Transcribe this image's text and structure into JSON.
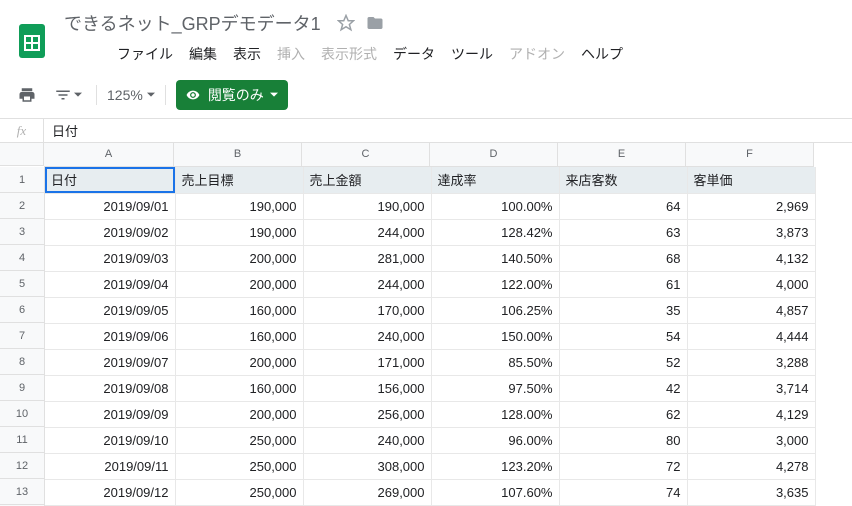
{
  "header": {
    "title": "できるネット_GRPデモデータ1"
  },
  "menu": {
    "file": "ファイル",
    "edit": "編集",
    "view": "表示",
    "insert": "挿入",
    "format": "表示形式",
    "data": "データ",
    "tools": "ツール",
    "addons": "アドオン",
    "help": "ヘルプ"
  },
  "toolbar": {
    "zoom": "125%",
    "view_only": "閲覧のみ"
  },
  "fx": {
    "label": "fx",
    "value": "日付"
  },
  "columns": [
    "A",
    "B",
    "C",
    "D",
    "E",
    "F"
  ],
  "row_numbers": [
    "1",
    "2",
    "3",
    "4",
    "5",
    "6",
    "7",
    "8",
    "9",
    "10",
    "11",
    "12",
    "13"
  ],
  "table": {
    "headers": {
      "c0": "日付",
      "c1": "売上目標",
      "c2": "売上金額",
      "c3": "達成率",
      "c4": "来店客数",
      "c5": "客単価"
    },
    "rows": [
      {
        "c0": "2019/09/01",
        "c1": "190,000",
        "c2": "190,000",
        "c3": "100.00%",
        "c4": "64",
        "c5": "2,969"
      },
      {
        "c0": "2019/09/02",
        "c1": "190,000",
        "c2": "244,000",
        "c3": "128.42%",
        "c4": "63",
        "c5": "3,873"
      },
      {
        "c0": "2019/09/03",
        "c1": "200,000",
        "c2": "281,000",
        "c3": "140.50%",
        "c4": "68",
        "c5": "4,132"
      },
      {
        "c0": "2019/09/04",
        "c1": "200,000",
        "c2": "244,000",
        "c3": "122.00%",
        "c4": "61",
        "c5": "4,000"
      },
      {
        "c0": "2019/09/05",
        "c1": "160,000",
        "c2": "170,000",
        "c3": "106.25%",
        "c4": "35",
        "c5": "4,857"
      },
      {
        "c0": "2019/09/06",
        "c1": "160,000",
        "c2": "240,000",
        "c3": "150.00%",
        "c4": "54",
        "c5": "4,444"
      },
      {
        "c0": "2019/09/07",
        "c1": "200,000",
        "c2": "171,000",
        "c3": "85.50%",
        "c4": "52",
        "c5": "3,288"
      },
      {
        "c0": "2019/09/08",
        "c1": "160,000",
        "c2": "156,000",
        "c3": "97.50%",
        "c4": "42",
        "c5": "3,714"
      },
      {
        "c0": "2019/09/09",
        "c1": "200,000",
        "c2": "256,000",
        "c3": "128.00%",
        "c4": "62",
        "c5": "4,129"
      },
      {
        "c0": "2019/09/10",
        "c1": "250,000",
        "c2": "240,000",
        "c3": "96.00%",
        "c4": "80",
        "c5": "3,000"
      },
      {
        "c0": "2019/09/11",
        "c1": "250,000",
        "c2": "308,000",
        "c3": "123.20%",
        "c4": "72",
        "c5": "4,278"
      },
      {
        "c0": "2019/09/12",
        "c1": "250,000",
        "c2": "269,000",
        "c3": "107.60%",
        "c4": "74",
        "c5": "3,635"
      }
    ]
  }
}
